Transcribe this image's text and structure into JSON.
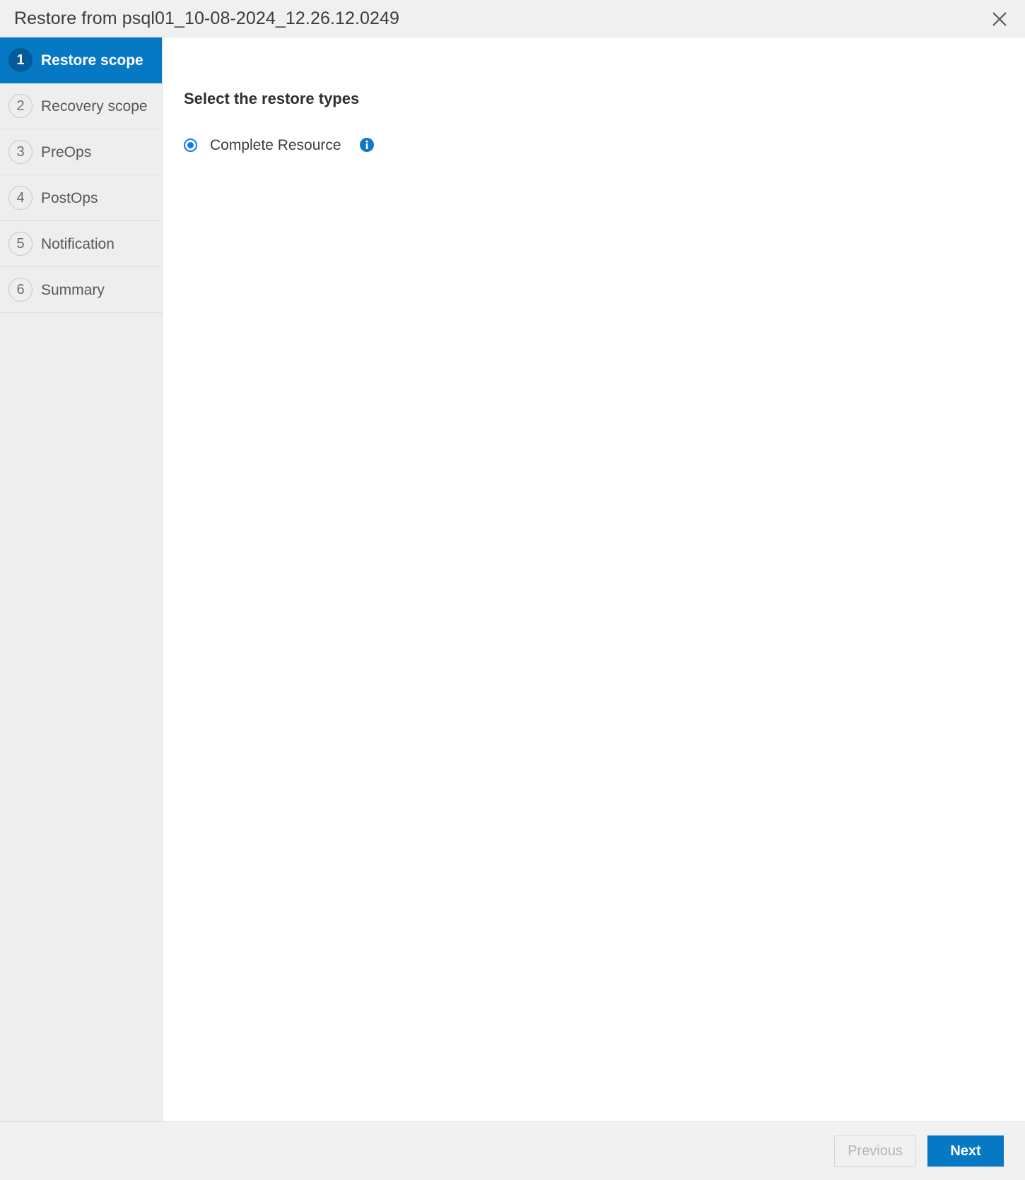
{
  "window": {
    "title": "Restore from psql01_10-08-2024_12.26.12.0249",
    "close_icon": "close-icon"
  },
  "sidebar": {
    "steps": [
      {
        "number": "1",
        "label": "Restore scope",
        "active": true
      },
      {
        "number": "2",
        "label": "Recovery scope",
        "active": false
      },
      {
        "number": "3",
        "label": "PreOps",
        "active": false
      },
      {
        "number": "4",
        "label": "PostOps",
        "active": false
      },
      {
        "number": "5",
        "label": "Notification",
        "active": false
      },
      {
        "number": "6",
        "label": "Summary",
        "active": false
      }
    ]
  },
  "main": {
    "heading": "Select the restore types",
    "options": [
      {
        "label": "Complete Resource",
        "selected": true,
        "info_icon": "info-icon"
      }
    ]
  },
  "footer": {
    "previous_label": "Previous",
    "next_label": "Next"
  },
  "colors": {
    "accent_blue": "#0678c4",
    "badge_blue": "#035b9a",
    "radio_blue": "#0d7ef0",
    "sidebar_bg": "#eeeeee",
    "titlebar_bg": "#f0f0f0",
    "footer_bg": "#f1f1f1"
  }
}
